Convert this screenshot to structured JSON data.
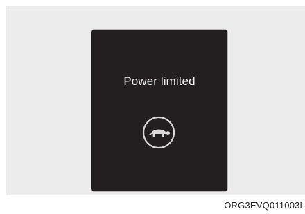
{
  "display": {
    "message": "Power limited",
    "indicator_icon": "turtle-icon",
    "background_color": "#231f20",
    "text_color": "#f2f2f2",
    "icon_color": "#d9d9d9"
  },
  "caption": {
    "code": "ORG3EVQ011003L"
  }
}
